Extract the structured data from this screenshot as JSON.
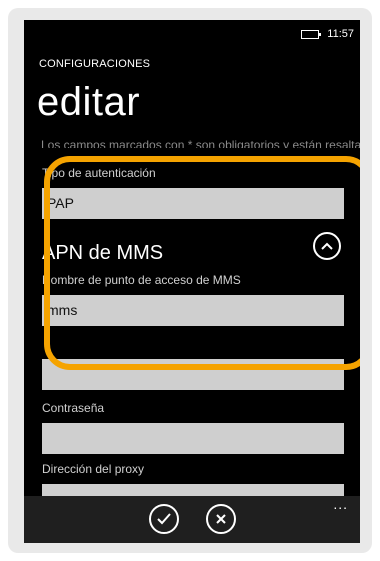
{
  "status": {
    "time": "11:57",
    "battery_icon": "battery-icon"
  },
  "header": {
    "app_title": "CONFIGURACIONES",
    "page_title": "editar"
  },
  "partial_text": "Los campos marcados con * son obligatorios y están resaltados",
  "fields": {
    "auth_type": {
      "label": "Tipo de autenticación",
      "value": "PAP"
    },
    "mms_section": {
      "title": "APN de MMS",
      "collapse_icon": "chevron-up-circle-icon"
    },
    "mms_apn": {
      "label": "Nombre de punto de acceso de MMS",
      "value": "mms"
    },
    "user_field_value": "",
    "password": {
      "label": "Contraseña",
      "value": ""
    },
    "proxy": {
      "label": "Dirección del proxy",
      "value": ""
    }
  },
  "appbar": {
    "save_icon": "check-circle-icon",
    "cancel_icon": "close-circle-icon",
    "more_label": "..."
  },
  "colors": {
    "highlight": "#f5a300",
    "field_bg": "#cfcfcf",
    "appbar_bg": "#1f1f1f"
  }
}
